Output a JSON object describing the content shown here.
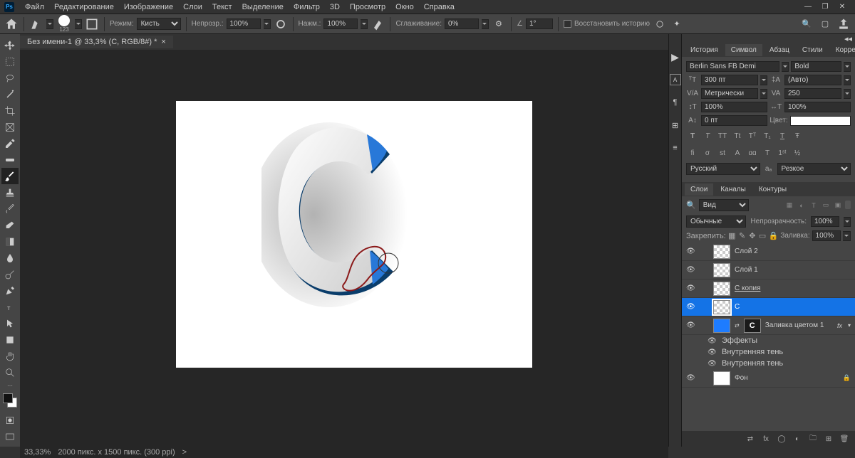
{
  "app": {
    "logo": "Ps"
  },
  "menubar": [
    "Файл",
    "Редактирование",
    "Изображение",
    "Слои",
    "Текст",
    "Выделение",
    "Фильтр",
    "3D",
    "Просмотр",
    "Окно",
    "Справка"
  ],
  "win": {
    "min": "—",
    "max": "❐",
    "close": "✕"
  },
  "optbar": {
    "brush_size": "123",
    "mode_label": "Режим:",
    "mode_value": "Кисть",
    "opacity_label": "Непрозр.:",
    "opacity_value": "100%",
    "flow_label": "Нажм.:",
    "flow_value": "100%",
    "smooth_label": "Сглаживание:",
    "smooth_value": "0%",
    "angle_value": "1°",
    "history_label": "Восстановить историю"
  },
  "doc": {
    "title": "Без имени-1 @ 33,3% (C, RGB/8#) *",
    "close": "×"
  },
  "status": {
    "zoom": "33,33%",
    "info": "2000 пикс. x 1500 пикс. (300 ppi)",
    "arrow": ">"
  },
  "panel_group1": {
    "tabs": [
      "История",
      "Символ",
      "Абзац",
      "Стили",
      "Коррекция"
    ],
    "active": 1
  },
  "character": {
    "font": "Berlin Sans FB Demi",
    "weight": "Bold",
    "size": "300 пт",
    "leading": "(Авто)",
    "kerning": "Метрически",
    "tracking": "250",
    "vscale": "100%",
    "hscale": "100%",
    "baseline": "0 пт",
    "color_label": "Цвет:",
    "lang": "Русский",
    "aa": "Резкое",
    "type_btns": [
      "T",
      "T",
      "TT",
      "Tt",
      "Tᵀ",
      "T₁",
      "T",
      "Ŧ"
    ],
    "ot_btns": [
      "fi",
      "σ",
      "st",
      "A",
      "ɑɑ",
      "T",
      "1ˢᵗ",
      "½"
    ]
  },
  "panel_group2": {
    "tabs": [
      "Слои",
      "Каналы",
      "Контуры"
    ],
    "active": 0
  },
  "layers": {
    "search_kind": "Вид",
    "blend": "Обычные",
    "opacity_label": "Непрозрачность:",
    "opacity": "100%",
    "lock_label": "Закрепить:",
    "fill_label": "Заливка:",
    "fill": "100%",
    "items": [
      {
        "name": "Слой 2",
        "thumb": "checker"
      },
      {
        "name": "Слой 1",
        "thumb": "checker"
      },
      {
        "name": "С копия",
        "thumb": "checker",
        "underline": true
      },
      {
        "name": "C",
        "thumb": "checker",
        "selected": true
      },
      {
        "name": "Заливка цветом 1",
        "thumb": "blue",
        "mask": "dark",
        "fx": true
      },
      {
        "name": "Фон",
        "thumb": "white",
        "locked": true
      }
    ],
    "effects_label": "Эффекты",
    "effect_inner_shadow": "Внутренняя тень",
    "fx_text": "fx"
  },
  "search_icon": "🔍"
}
